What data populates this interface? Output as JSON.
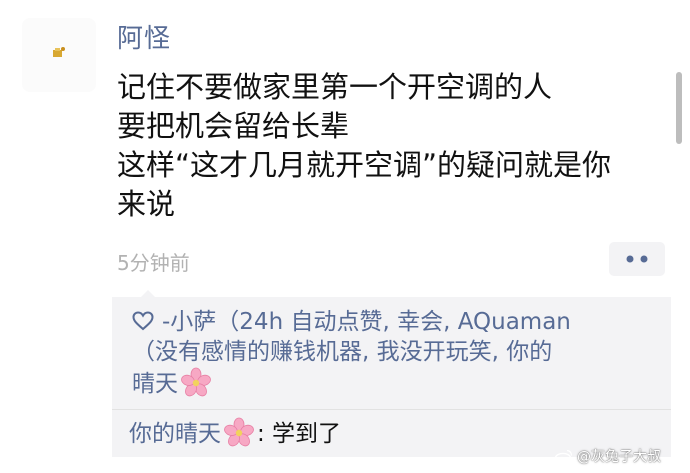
{
  "post": {
    "author": "阿怪",
    "lines": [
      "记住不要做家里第一个开空调的人",
      "要把机会留给长辈",
      "这样“这才几月就开空调”的疑问就是你",
      "来说"
    ],
    "time": "5分钟前",
    "more_icon": "more-dots-icon"
  },
  "likes": {
    "icon": "heart-outline-icon",
    "text_line1": "-小萨（24h 自动点赞, 幸会, AQuaman",
    "text_line2": "（没有感情的赚钱机器, 我没开玩笑, 你的",
    "text_line3": "晴天",
    "emoji": "cherry-blossom-icon"
  },
  "comment": {
    "author": "你的晴天",
    "emoji": "cherry-blossom-icon",
    "text": ": 学到了"
  },
  "watermark": {
    "icon": "weibo-icon",
    "text": "@灰兔子大叔"
  },
  "colors": {
    "link_blue": "#576b95",
    "panel_bg": "#f3f3f5",
    "time_gray": "#b2b2b2"
  }
}
